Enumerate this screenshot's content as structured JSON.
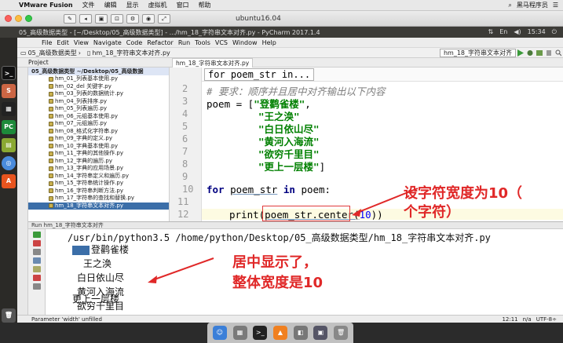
{
  "mac_menubar": {
    "app": "VMware Fusion",
    "menus": [
      "文件",
      "编辑",
      "显示",
      "虚拟机",
      "窗口",
      "帮助"
    ],
    "right_text": "黑马程序员"
  },
  "vm_window": {
    "title": "ubuntu16.04"
  },
  "ubuntu_bar": {
    "title": "05_高级数据类型 - [~/Desktop/05_高级数据类型] - .../hm_18_字符串文本对齐.py - PyCharm 2017.1.4",
    "time": "15:34"
  },
  "pycharm": {
    "menu": [
      "File",
      "Edit",
      "View",
      "Navigate",
      "Code",
      "Refactor",
      "Run",
      "Tools",
      "VCS",
      "Window",
      "Help"
    ],
    "nav_crumbs": [
      "05_高级数据类型",
      "hm_18_字符串文本对齐.py"
    ],
    "run_config": "hm_18_字符串文本对齐",
    "project_tab": "Project",
    "editor_tab": "hm_18_字符串文本对齐.py",
    "project": {
      "root": "05_高级数据类型  ~/Desktop/05_高级数据",
      "files": [
        "hm_01_列表基本使用.py",
        "hm_02_del 关键字.py",
        "hm_03_列表的数据统计.py",
        "hm_04_列表排序.py",
        "hm_05_列表遍历.py",
        "hm_06_元组基本使用.py",
        "hm_07_元组遍历.py",
        "hm_08_格式化字符串.py",
        "hm_09_字典的定义.py",
        "hm_10_字典基本使用.py",
        "hm_11_字典的其他操作.py",
        "hm_12_字典的遍历.py",
        "hm_13_字典的应用场景.py",
        "hm_14_字符串定义和遍历.py",
        "hm_15_字符串统计操作.py",
        "hm_16_字符串判断方法.py",
        "hm_17_字符串的查找和替换.py",
        "hm_18_字符串文本对齐.py"
      ]
    },
    "editor": {
      "breadcrumb": "for poem_str in...",
      "line_numbers": [
        "2",
        "3",
        "4",
        "5",
        "6",
        "7",
        "8",
        "9",
        "10",
        "11",
        "12"
      ],
      "lines": {
        "l2": "# 要求：顺序并且居中对齐输出以下内容",
        "l3_prefix": "poem = [",
        "l3_str": "\"登鹳雀楼\"",
        "l3_suffix": ",",
        "l4": "\"王之涣\"",
        "l5": "\"白日依山尽\"",
        "l6": "\"黄河入海流\"",
        "l7": "\"欲穷千里目\"",
        "l8": "\"更上一层楼\"",
        "l8_end": "]",
        "l10_kw1": "for",
        "l10_var": "poem_str",
        "l10_kw2": "in",
        "l10_rest": "poem:",
        "l12_func": "print(",
        "l12_call": "poem_str.center(",
        "l12_num": "10",
        "l12_end": "))"
      }
    },
    "run": {
      "header": "Run  hm_18_字符串文本对齐",
      "command": "/usr/bin/python3.5 /home/python/Desktop/05_高级数据类型/hm_18_字符串文本对齐.py",
      "output": [
        "登鹳雀楼",
        "王之涣",
        "白日依山尽",
        "黄河入海流",
        "欲穷千里目",
        "更上一层楼"
      ]
    },
    "status": {
      "left": "Parameter 'width' unfilled",
      "pos": "12:11",
      "sep": "n/a",
      "enc": "UTF-8÷"
    }
  },
  "annotations": {
    "a1_line1": "设字符宽度为10（",
    "a1_line2": "个字符）",
    "a2_line1": "居中显示了，",
    "a2_line2": "整体宽度是10"
  }
}
